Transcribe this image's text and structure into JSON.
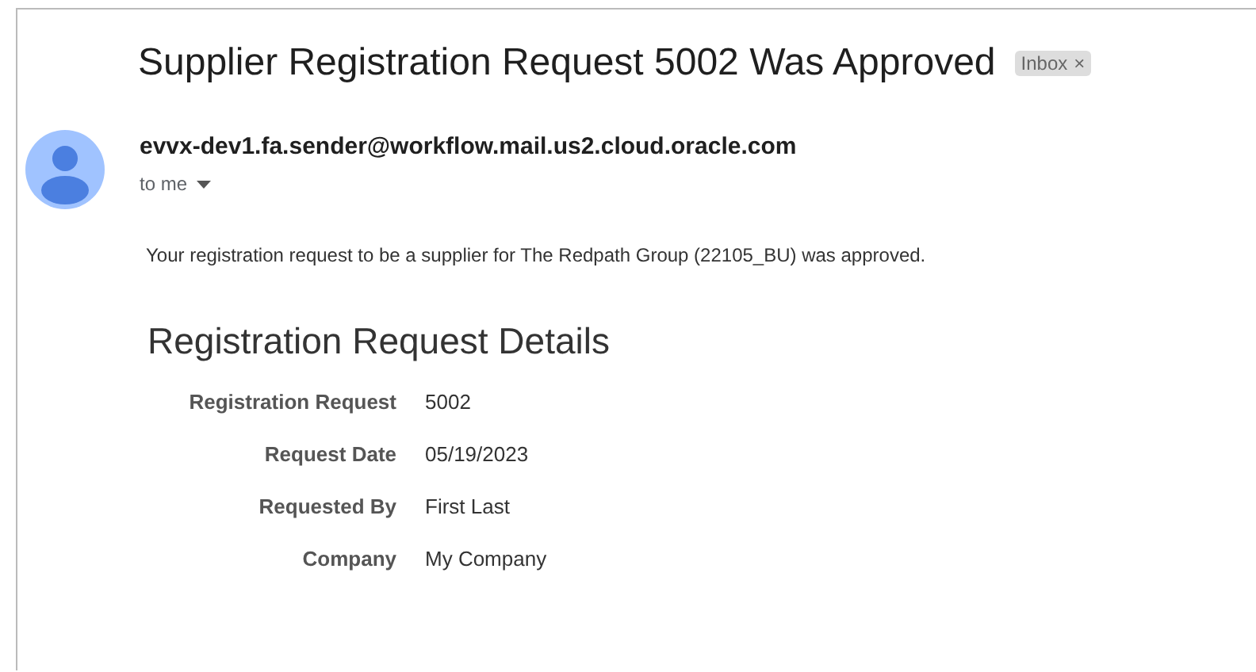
{
  "email": {
    "subject": "Supplier Registration Request 5002 Was Approved",
    "label": {
      "text": "Inbox",
      "close": "×"
    },
    "sender": "evvx-dev1.fa.sender@workflow.mail.us2.cloud.oracle.com",
    "recipient": "to me",
    "body": "Your registration request to be a supplier for The Redpath Group (22105_BU) was approved.",
    "details_heading": "Registration Request Details",
    "details": [
      {
        "label": "Registration Request",
        "value": "5002"
      },
      {
        "label": "Request Date",
        "value": "05/19/2023"
      },
      {
        "label": "Requested By",
        "value": "First Last"
      },
      {
        "label": "Company",
        "value": "My Company"
      }
    ]
  }
}
